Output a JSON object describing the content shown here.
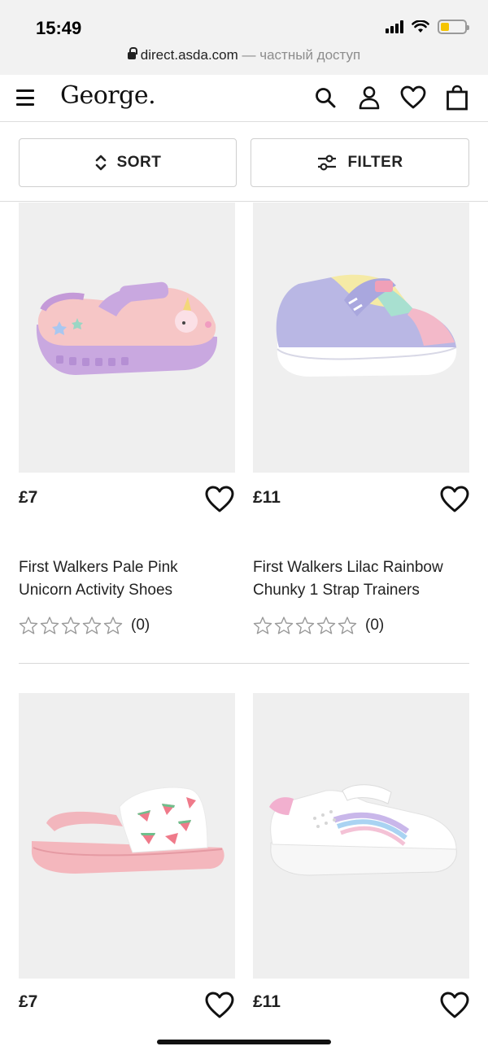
{
  "status_bar": {
    "time": "15:49",
    "battery_level": 0.35
  },
  "browser": {
    "url": "direct.asda.com",
    "separator": " — ",
    "private_label": "частный доступ"
  },
  "header": {
    "logo": "George.",
    "icons": [
      "menu-icon",
      "search-icon",
      "account-icon",
      "wishlist-heart-icon",
      "basket-icon"
    ]
  },
  "toolbar": {
    "sort_label": "SORT",
    "filter_label": "FILTER"
  },
  "products": [
    {
      "price": "£7",
      "name_line1": "First Walkers Pale Pink",
      "name_line2": "Unicorn Activity Shoes",
      "rating_stars": 0,
      "review_count": "(0)"
    },
    {
      "price": "£11",
      "name_line1": "First Walkers Lilac Rainbow",
      "name_line2": "Chunky 1 Strap Trainers",
      "rating_stars": 0,
      "review_count": "(0)"
    },
    {
      "price": "£7"
    },
    {
      "price": "£11"
    }
  ],
  "colors": {
    "accent_yellow": "#f5c400",
    "text": "#222222",
    "image_bg": "#efefef"
  }
}
